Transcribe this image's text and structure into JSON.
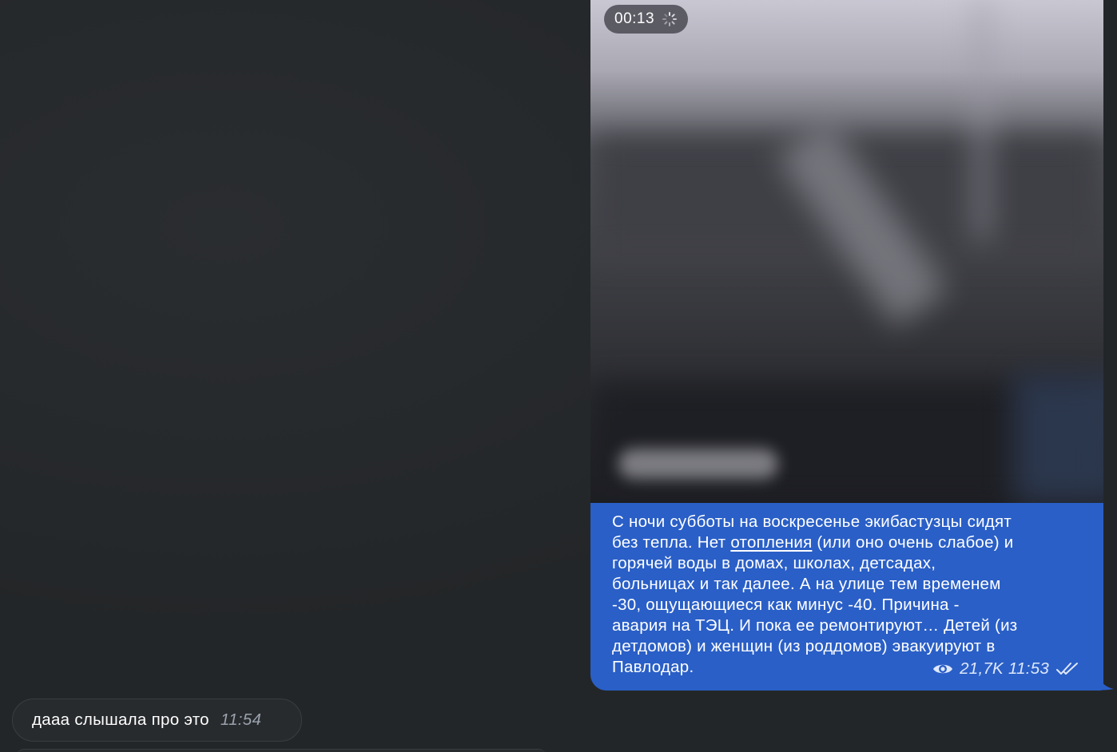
{
  "outgoing_message": {
    "video": {
      "duration": "00:13",
      "loading_icon": "spinner-icon"
    },
    "caption": {
      "line1": "С ночи субботы на воскресенье экибастузцы сидят",
      "line2_before": "без тепла. Нет ",
      "line2_link": "отопления",
      "line2_after": " (или оно очень слабое) и",
      "line3": "горячей воды в домах, школах, детсадах,",
      "line4": "больницах и так далее. А на улице тем временем",
      "line5": "-30, ощущающиеся как минус -40. Причина -",
      "line6": "авария на ТЭЦ. И пока ее ремонтируют… Детей (из",
      "line7": "детдомов) и женщин (из роддомов) эвакуируют в",
      "line8": "Павлодар."
    },
    "views": "21,7K",
    "time": "11:53",
    "views_icon": "eye-icon",
    "status_icon": "double-check-icon",
    "bubble_color": "#2a5fc7"
  },
  "incoming_message": {
    "text": "дааа слышала про это",
    "time": "11:54"
  },
  "colors": {
    "background": "#232628",
    "incoming_bubble": "#282b2e",
    "accent": "#2a5fc7"
  }
}
